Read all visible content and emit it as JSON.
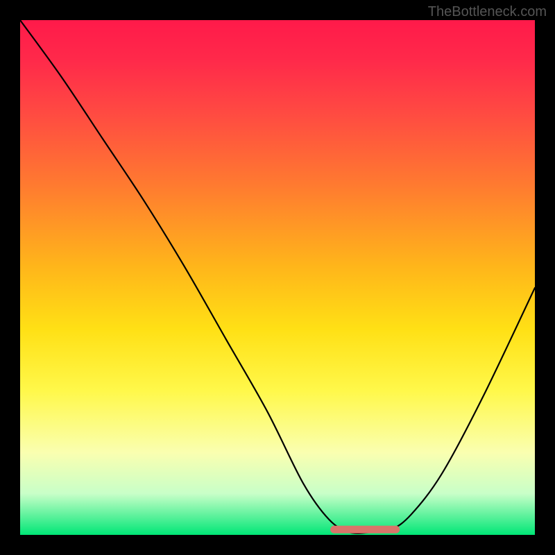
{
  "watermark": "TheBottleneck.com",
  "chart_data": {
    "type": "line",
    "title": "",
    "xlabel": "",
    "ylabel": "",
    "xlim": [
      0,
      100
    ],
    "ylim": [
      0,
      100
    ],
    "grid": false,
    "legend": false,
    "series": [
      {
        "name": "bottleneck-curve",
        "x": [
          0,
          8,
          16,
          24,
          32,
          40,
          48,
          55,
          60,
          64,
          68,
          72,
          76,
          82,
          90,
          100
        ],
        "y": [
          100,
          89,
          77,
          65,
          52,
          38,
          24,
          10,
          3,
          0.5,
          0.5,
          1,
          4,
          12,
          27,
          48
        ]
      }
    ],
    "annotations": [
      {
        "type": "flat-segment",
        "x_range": [
          61,
          73
        ],
        "y": 0.5,
        "color": "#d9756a",
        "note": "optimal-range-marker"
      }
    ],
    "background_gradient": {
      "direction": "vertical",
      "stops": [
        {
          "pos": 0,
          "color": "#ff1a4a"
        },
        {
          "pos": 50,
          "color": "#ffd020"
        },
        {
          "pos": 85,
          "color": "#faffb0"
        },
        {
          "pos": 100,
          "color": "#00e676"
        }
      ]
    }
  }
}
